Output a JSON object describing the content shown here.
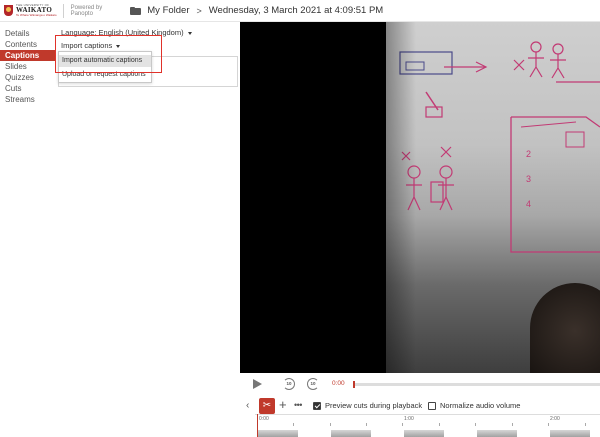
{
  "header": {
    "logo_small": "THE UNIVERSITY OF",
    "logo_main": "WAIKATO",
    "logo_sub": "Te Whare Wānanga o Waikato",
    "powered_by_line1": "Powered by",
    "powered_by_line2": "Panopto",
    "folder_label": "My Folder",
    "separator": ">",
    "session_title": "Wednesday, 3 March 2021 at 4:09:51 PM"
  },
  "sidebar": {
    "items": [
      {
        "label": "Details"
      },
      {
        "label": "Contents"
      },
      {
        "label": "Captions",
        "active": true
      },
      {
        "label": "Slides"
      },
      {
        "label": "Quizzes"
      },
      {
        "label": "Cuts"
      },
      {
        "label": "Streams"
      }
    ]
  },
  "captions_panel": {
    "language_label": "Language: English (United Kingdom)",
    "import_button": "Import captions",
    "dropdown_items": [
      {
        "label": "Import automatic captions",
        "highlighted": true
      },
      {
        "label": "Upload or request captions",
        "highlighted": false
      }
    ]
  },
  "player": {
    "current_time": "0:00",
    "skip_back_seconds": "10",
    "skip_forward_seconds": "10"
  },
  "editor": {
    "preview_cuts_label": "Preview cuts during playback",
    "preview_cuts_checked": true,
    "normalize_audio_label": "Normalize audio volume",
    "normalize_audio_checked": false,
    "timeline_labels": [
      "0:00",
      "1:00",
      "2:00"
    ]
  },
  "colors": {
    "accent": "#c0392b",
    "highlight_outline": "#e0322a"
  }
}
